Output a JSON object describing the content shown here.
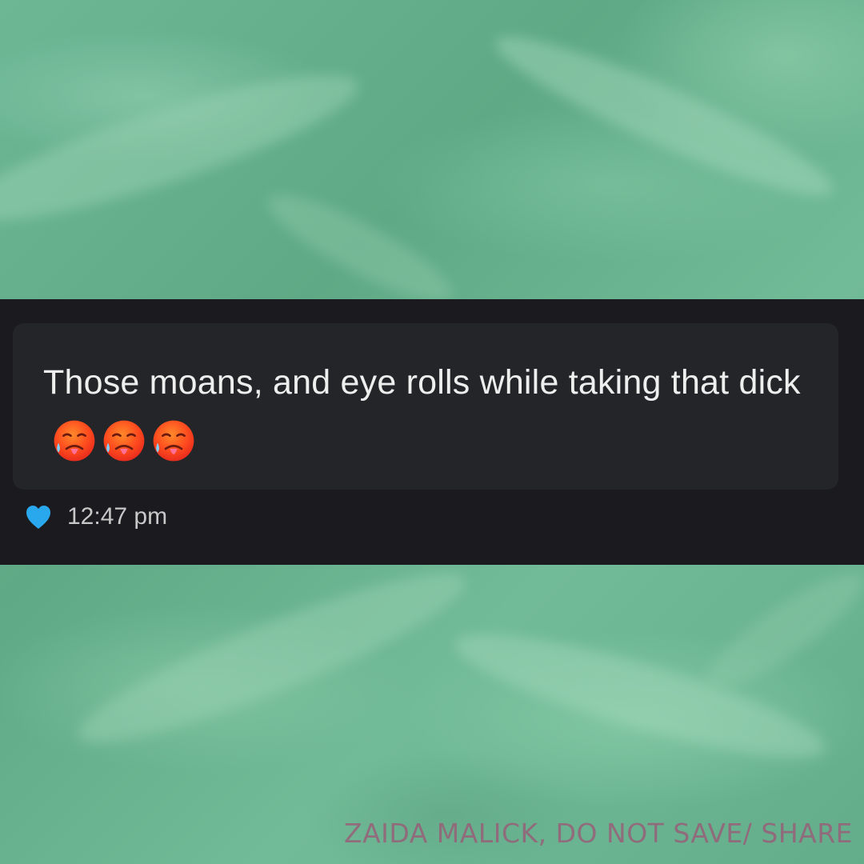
{
  "message": {
    "text": "Those moans, and eye rolls while taking that dick",
    "emojis": [
      "hot-face-icon",
      "hot-face-icon",
      "hot-face-icon"
    ],
    "reaction_icon": "heart-icon",
    "timestamp": "12:47 pm"
  },
  "watermark": {
    "text": "ZAIDA MALICK, DO NOT SAVE/ SHARE"
  },
  "colors": {
    "background_green": "#69b392",
    "chat_panel": "#1b1b1f",
    "bubble": "#242529",
    "message_text": "#eeeeee",
    "heart": "#2aa8ee",
    "timestamp": "#c8c8c8",
    "watermark": "#965f78"
  }
}
